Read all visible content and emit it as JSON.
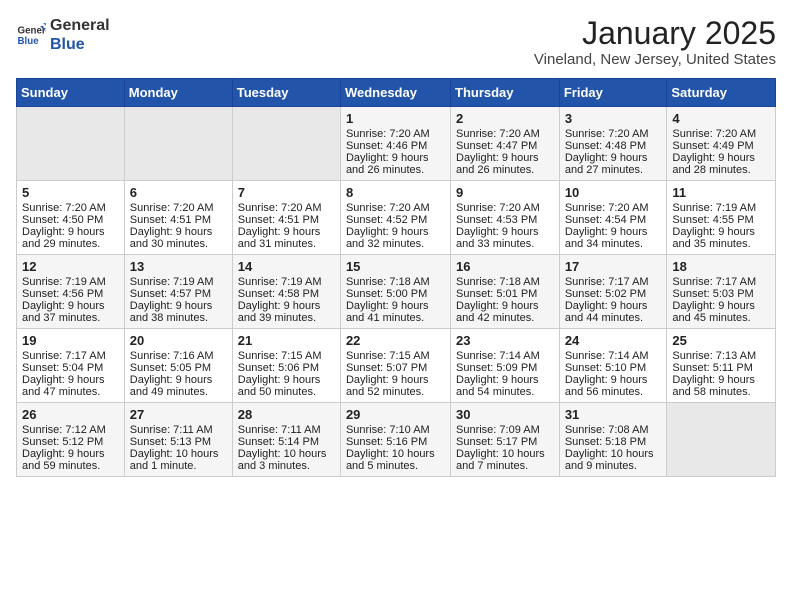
{
  "header": {
    "logo_general": "General",
    "logo_blue": "Blue",
    "month_title": "January 2025",
    "location": "Vineland, New Jersey, United States"
  },
  "days_of_week": [
    "Sunday",
    "Monday",
    "Tuesday",
    "Wednesday",
    "Thursday",
    "Friday",
    "Saturday"
  ],
  "weeks": [
    [
      {
        "day": "",
        "data": []
      },
      {
        "day": "",
        "data": []
      },
      {
        "day": "",
        "data": []
      },
      {
        "day": "1",
        "data": [
          "Sunrise: 7:20 AM",
          "Sunset: 4:46 PM",
          "Daylight: 9 hours and 26 minutes."
        ]
      },
      {
        "day": "2",
        "data": [
          "Sunrise: 7:20 AM",
          "Sunset: 4:47 PM",
          "Daylight: 9 hours and 26 minutes."
        ]
      },
      {
        "day": "3",
        "data": [
          "Sunrise: 7:20 AM",
          "Sunset: 4:48 PM",
          "Daylight: 9 hours and 27 minutes."
        ]
      },
      {
        "day": "4",
        "data": [
          "Sunrise: 7:20 AM",
          "Sunset: 4:49 PM",
          "Daylight: 9 hours and 28 minutes."
        ]
      }
    ],
    [
      {
        "day": "5",
        "data": [
          "Sunrise: 7:20 AM",
          "Sunset: 4:50 PM",
          "Daylight: 9 hours and 29 minutes."
        ]
      },
      {
        "day": "6",
        "data": [
          "Sunrise: 7:20 AM",
          "Sunset: 4:51 PM",
          "Daylight: 9 hours and 30 minutes."
        ]
      },
      {
        "day": "7",
        "data": [
          "Sunrise: 7:20 AM",
          "Sunset: 4:51 PM",
          "Daylight: 9 hours and 31 minutes."
        ]
      },
      {
        "day": "8",
        "data": [
          "Sunrise: 7:20 AM",
          "Sunset: 4:52 PM",
          "Daylight: 9 hours and 32 minutes."
        ]
      },
      {
        "day": "9",
        "data": [
          "Sunrise: 7:20 AM",
          "Sunset: 4:53 PM",
          "Daylight: 9 hours and 33 minutes."
        ]
      },
      {
        "day": "10",
        "data": [
          "Sunrise: 7:20 AM",
          "Sunset: 4:54 PM",
          "Daylight: 9 hours and 34 minutes."
        ]
      },
      {
        "day": "11",
        "data": [
          "Sunrise: 7:19 AM",
          "Sunset: 4:55 PM",
          "Daylight: 9 hours and 35 minutes."
        ]
      }
    ],
    [
      {
        "day": "12",
        "data": [
          "Sunrise: 7:19 AM",
          "Sunset: 4:56 PM",
          "Daylight: 9 hours and 37 minutes."
        ]
      },
      {
        "day": "13",
        "data": [
          "Sunrise: 7:19 AM",
          "Sunset: 4:57 PM",
          "Daylight: 9 hours and 38 minutes."
        ]
      },
      {
        "day": "14",
        "data": [
          "Sunrise: 7:19 AM",
          "Sunset: 4:58 PM",
          "Daylight: 9 hours and 39 minutes."
        ]
      },
      {
        "day": "15",
        "data": [
          "Sunrise: 7:18 AM",
          "Sunset: 5:00 PM",
          "Daylight: 9 hours and 41 minutes."
        ]
      },
      {
        "day": "16",
        "data": [
          "Sunrise: 7:18 AM",
          "Sunset: 5:01 PM",
          "Daylight: 9 hours and 42 minutes."
        ]
      },
      {
        "day": "17",
        "data": [
          "Sunrise: 7:17 AM",
          "Sunset: 5:02 PM",
          "Daylight: 9 hours and 44 minutes."
        ]
      },
      {
        "day": "18",
        "data": [
          "Sunrise: 7:17 AM",
          "Sunset: 5:03 PM",
          "Daylight: 9 hours and 45 minutes."
        ]
      }
    ],
    [
      {
        "day": "19",
        "data": [
          "Sunrise: 7:17 AM",
          "Sunset: 5:04 PM",
          "Daylight: 9 hours and 47 minutes."
        ]
      },
      {
        "day": "20",
        "data": [
          "Sunrise: 7:16 AM",
          "Sunset: 5:05 PM",
          "Daylight: 9 hours and 49 minutes."
        ]
      },
      {
        "day": "21",
        "data": [
          "Sunrise: 7:15 AM",
          "Sunset: 5:06 PM",
          "Daylight: 9 hours and 50 minutes."
        ]
      },
      {
        "day": "22",
        "data": [
          "Sunrise: 7:15 AM",
          "Sunset: 5:07 PM",
          "Daylight: 9 hours and 52 minutes."
        ]
      },
      {
        "day": "23",
        "data": [
          "Sunrise: 7:14 AM",
          "Sunset: 5:09 PM",
          "Daylight: 9 hours and 54 minutes."
        ]
      },
      {
        "day": "24",
        "data": [
          "Sunrise: 7:14 AM",
          "Sunset: 5:10 PM",
          "Daylight: 9 hours and 56 minutes."
        ]
      },
      {
        "day": "25",
        "data": [
          "Sunrise: 7:13 AM",
          "Sunset: 5:11 PM",
          "Daylight: 9 hours and 58 minutes."
        ]
      }
    ],
    [
      {
        "day": "26",
        "data": [
          "Sunrise: 7:12 AM",
          "Sunset: 5:12 PM",
          "Daylight: 9 hours and 59 minutes."
        ]
      },
      {
        "day": "27",
        "data": [
          "Sunrise: 7:11 AM",
          "Sunset: 5:13 PM",
          "Daylight: 10 hours and 1 minute."
        ]
      },
      {
        "day": "28",
        "data": [
          "Sunrise: 7:11 AM",
          "Sunset: 5:14 PM",
          "Daylight: 10 hours and 3 minutes."
        ]
      },
      {
        "day": "29",
        "data": [
          "Sunrise: 7:10 AM",
          "Sunset: 5:16 PM",
          "Daylight: 10 hours and 5 minutes."
        ]
      },
      {
        "day": "30",
        "data": [
          "Sunrise: 7:09 AM",
          "Sunset: 5:17 PM",
          "Daylight: 10 hours and 7 minutes."
        ]
      },
      {
        "day": "31",
        "data": [
          "Sunrise: 7:08 AM",
          "Sunset: 5:18 PM",
          "Daylight: 10 hours and 9 minutes."
        ]
      },
      {
        "day": "",
        "data": []
      }
    ]
  ]
}
